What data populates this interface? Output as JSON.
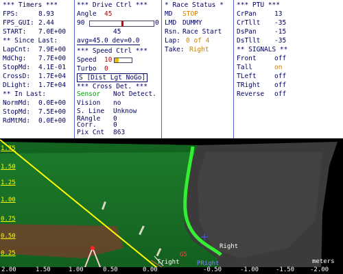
{
  "timers": {
    "title": "*** Timers ***",
    "fps_label": "FPS:",
    "fps": "8.93",
    "fps_gui_label": "FPS_GUI:",
    "fps_gui": "2.44",
    "start_label": "START:",
    "start": "7.0E+00",
    "since_last_title": "** Since Last:",
    "lapcnt_label": "LapCnt:",
    "lapcnt": "7.9E+00",
    "mdchg_label": "MdChg:",
    "mdchg": "7.7E+00",
    "stopmd_label": "StopMd:",
    "stopmd": "4.1E-01",
    "crossd_label": "CrossD:",
    "crossd": "1.7E+04",
    "dlight_label": "DLight:",
    "dlight": "1.7E+04",
    "in_last_title": "** In Last:",
    "normmd_label": "NormMd:",
    "normmd": "0.0E+00",
    "stopmd2_label": "StopMd:",
    "stopmd2": "7.5E+00",
    "rdmtmd_label": "RdMtMd:",
    "rdmtmd": "0.0E+00"
  },
  "drive": {
    "title": "***  Drive Ctrl  ***",
    "angle_label": "Angle",
    "angle": "45",
    "slider_min": "90",
    "slider_max": "0",
    "slider_fraction": 0.5,
    "slider_value": "45",
    "avg_dev": "avg=45.0 dev=0.0",
    "speed_title": "***  Speed Ctrl  ***",
    "speed_label": "Speed",
    "speed": "10",
    "turbo_label": "Turbo",
    "turbo": "0",
    "mode_button": "S [Dist Lgt NoGo]",
    "cross_title": "*** Cross Det. ***",
    "sensor_label": "Sensor",
    "sensor": "Not Detect.",
    "vision_label": "Vision",
    "vision": "no",
    "sline_label": "S. Line",
    "sline": "Unknow",
    "rangle_label": "RAngle",
    "rangle": "0",
    "corr_label": "Corr.",
    "corr": "0",
    "pixcnt_label": "Pix Cnt",
    "pixcnt": "863"
  },
  "race": {
    "title": "* Race Status *",
    "md_label": "MD",
    "md": "STOP",
    "lmd_label": "LMD",
    "lmd": "DUMMY",
    "rsn_label": "Rsn.",
    "rsn": "Race Start",
    "lap_label": "Lap:",
    "lap": "0 of 4",
    "take_label": "Take:",
    "take": "Right"
  },
  "ptu": {
    "title": "*** PTU ***",
    "crpan_label": "CrPan",
    "crpan": "13",
    "crtilt_label": "CrTllt",
    "crtilt": "-35",
    "dspan_label": "DsPan",
    "dspan": "-15",
    "dstilt_label": "DsTllt",
    "dstilt": "-35",
    "signals_title": "** SIGNALS **",
    "front_label": "Front",
    "front": "off",
    "tail_label": "Tall",
    "tail": "on",
    "tleft_label": "TLeft",
    "tleft": "off",
    "tright_label": "TRight",
    "tright": "off",
    "reverse_label": "Reverse",
    "reverse": "off"
  },
  "view": {
    "y_ticks": [
      "1.75",
      "1.50",
      "1.25",
      "1.00",
      "0.75",
      "0.50",
      "0.25"
    ],
    "x_ticks": [
      "2.00",
      "1.50",
      "1.00",
      "0.50",
      "0.00",
      "-0.50",
      "-1.00",
      "-1.50",
      "-2.00"
    ],
    "units": "meters",
    "right_label": "Right",
    "tright_marker": "Tright",
    "pright_marker": "PRight",
    "g5_label": "G5",
    "colors": {
      "track_line": "#33ee33",
      "guide_line": "#ffff00",
      "floor": "#1f7a28",
      "marker": "#ff2222"
    }
  }
}
